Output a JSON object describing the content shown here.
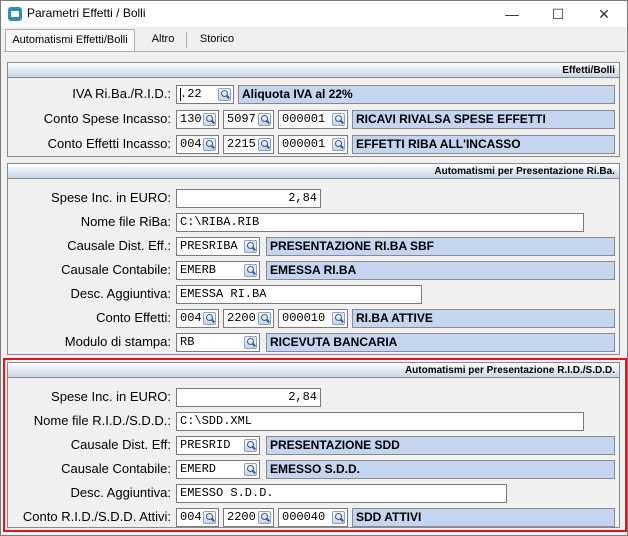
{
  "window": {
    "title": "Parametri Effetti / Bolli",
    "minimize": "—",
    "maximize": "☐",
    "close": "✕"
  },
  "tabs": [
    {
      "label": "Automatismi Effetti/Bolli"
    },
    {
      "label": "Altro"
    },
    {
      "label": "Storico"
    }
  ],
  "effetti_bolli": {
    "header": "Effetti/Bolli",
    "iva_label": "IVA Ri.Ba./R.I.D.:",
    "iva_code": ".22",
    "iva_desc": "Aliquota IVA al 22%",
    "spese_label": "Conto Spese Incasso:",
    "spese_a": "130",
    "spese_b": "5097",
    "spese_c": "000001",
    "spese_desc": "RICAVI RIVALSA SPESE EFFETTI",
    "effetti_label": "Conto Effetti Incasso:",
    "effetti_a": "004",
    "effetti_b": "2215",
    "effetti_c": "000001",
    "effetti_desc": "EFFETTI RIBA ALL'INCASSO"
  },
  "riba": {
    "header": "Automatismi per Presentazione Ri.Ba.",
    "spese_label": "Spese Inc. in EURO:",
    "spese_value": "2,84",
    "file_label": "Nome file RiBa:",
    "file_value": "C:\\RIBA.RIB",
    "causale_dist_label": "Causale Dist. Eff.:",
    "causale_dist_code": "PRESRIBA",
    "causale_dist_desc": "PRESENTAZIONE RI.BA SBF",
    "causale_cont_label": "Causale Contabile:",
    "causale_cont_code": "EMERB",
    "causale_cont_desc": "EMESSA RI.BA",
    "desc_agg_label": "Desc. Aggiuntiva:",
    "desc_agg_value": "EMESSA RI.BA",
    "conto_label": "Conto Effetti:",
    "conto_a": "004",
    "conto_b": "2200",
    "conto_c": "000010",
    "conto_desc": "RI.BA ATTIVE",
    "modulo_label": "Modulo di stampa:",
    "modulo_code": "RB",
    "modulo_desc": "RICEVUTA BANCARIA"
  },
  "rid": {
    "header": "Automatismi per Presentazione R.I.D./S.D.D.",
    "spese_label": "Spese Inc. in EURO:",
    "spese_value": "2,84",
    "file_label": "Nome file R.I.D./S.D.D.:",
    "file_value": "C:\\SDD.XML",
    "causale_dist_label": "Causale Dist. Eff:",
    "causale_dist_code": "PRESRID",
    "causale_dist_desc": "PRESENTAZIONE SDD",
    "causale_cont_label": "Causale Contabile:",
    "causale_cont_code": "EMERD",
    "causale_cont_desc": "EMESSO S.D.D.",
    "desc_agg_label": "Desc. Aggiuntiva:",
    "desc_agg_value": "EMESSO S.D.D.",
    "conto_label": "Conto R.I.D./S.D.D. Attivi:",
    "conto_a": "004",
    "conto_b": "2200",
    "conto_c": "000040",
    "conto_desc": "SDD ATTIVI"
  }
}
